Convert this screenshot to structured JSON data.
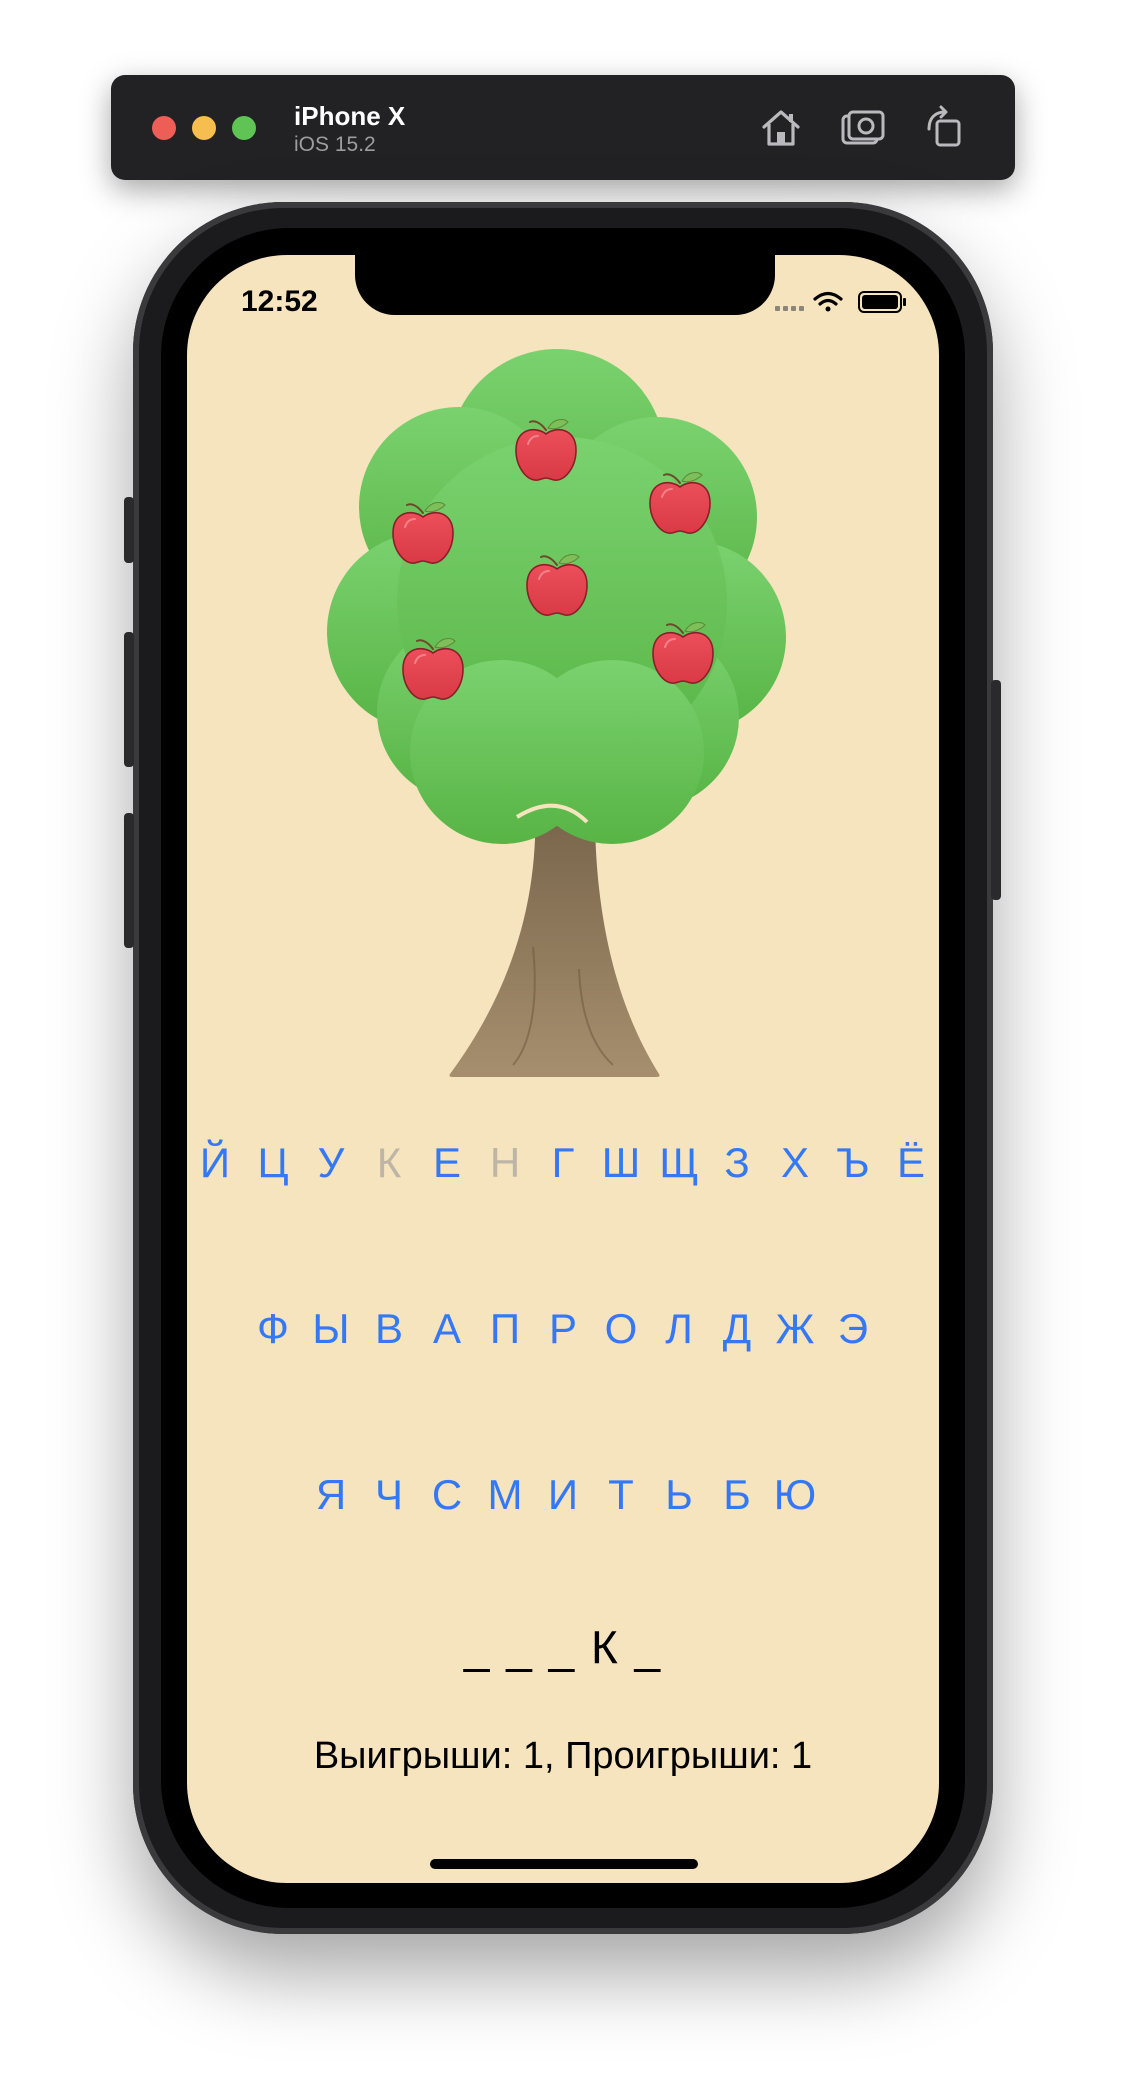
{
  "simulator": {
    "device_name": "iPhone X",
    "os_version": "iOS 15.2",
    "toolbar_icons": [
      "home-icon",
      "screenshot-icon",
      "rotate-icon"
    ]
  },
  "status_bar": {
    "time": "12:52",
    "icons": [
      "cellular-icon",
      "wifi-icon",
      "battery-icon"
    ]
  },
  "app": {
    "background_color": "#f5e4bd",
    "accent_color": "#3478f6",
    "disabled_color": "#bdb6a6",
    "tree": {
      "apples_remaining": 6
    },
    "keyboard": {
      "rows": [
        [
          {
            "letter": "Й",
            "enabled": true
          },
          {
            "letter": "Ц",
            "enabled": true
          },
          {
            "letter": "У",
            "enabled": true
          },
          {
            "letter": "К",
            "enabled": false
          },
          {
            "letter": "Е",
            "enabled": true
          },
          {
            "letter": "Н",
            "enabled": false
          },
          {
            "letter": "Г",
            "enabled": true
          },
          {
            "letter": "Ш",
            "enabled": true
          },
          {
            "letter": "Щ",
            "enabled": true
          },
          {
            "letter": "З",
            "enabled": true
          },
          {
            "letter": "Х",
            "enabled": true
          },
          {
            "letter": "Ъ",
            "enabled": true
          },
          {
            "letter": "Ё",
            "enabled": true
          }
        ],
        [
          {
            "letter": "Ф",
            "enabled": true
          },
          {
            "letter": "Ы",
            "enabled": true
          },
          {
            "letter": "В",
            "enabled": true
          },
          {
            "letter": "А",
            "enabled": true
          },
          {
            "letter": "П",
            "enabled": true
          },
          {
            "letter": "Р",
            "enabled": true
          },
          {
            "letter": "О",
            "enabled": true
          },
          {
            "letter": "Л",
            "enabled": true
          },
          {
            "letter": "Д",
            "enabled": true
          },
          {
            "letter": "Ж",
            "enabled": true
          },
          {
            "letter": "Э",
            "enabled": true
          }
        ],
        [
          {
            "letter": "Я",
            "enabled": true
          },
          {
            "letter": "Ч",
            "enabled": true
          },
          {
            "letter": "С",
            "enabled": true
          },
          {
            "letter": "М",
            "enabled": true
          },
          {
            "letter": "И",
            "enabled": true
          },
          {
            "letter": "Т",
            "enabled": true
          },
          {
            "letter": "Ь",
            "enabled": true
          },
          {
            "letter": "Б",
            "enabled": true
          },
          {
            "letter": "Ю",
            "enabled": true
          }
        ]
      ]
    },
    "word_display": "_ _ _ К _",
    "score_text": "Выигрыши: 1, Проигрыши: 1"
  }
}
